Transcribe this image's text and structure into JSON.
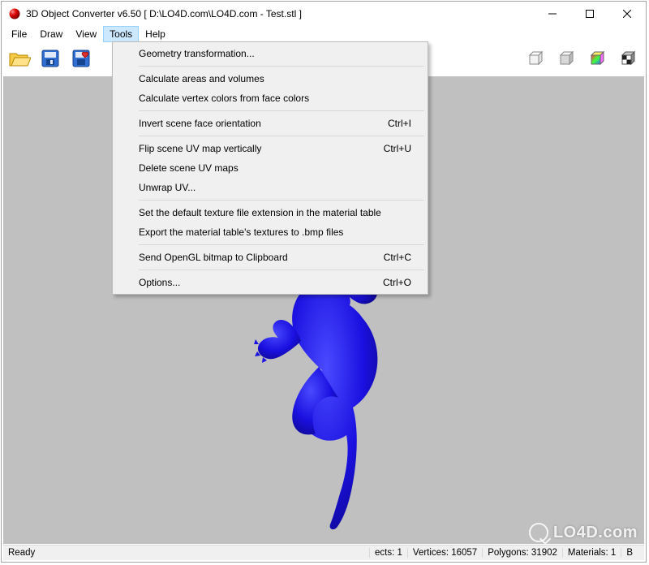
{
  "window": {
    "title": "3D Object Converter v6.50      [ D:\\LO4D.com\\LO4D.com - Test.stl ]"
  },
  "menubar": {
    "items": [
      "File",
      "Draw",
      "View",
      "Tools",
      "Help"
    ],
    "active_index": 3
  },
  "toolbar": {
    "left_icons": [
      "open-file-icon",
      "save-icon",
      "save-loved-icon"
    ],
    "right_icons": [
      "cube-wire-icon",
      "cube-solid-icon",
      "cube-rainbow-icon",
      "cube-checker-icon"
    ]
  },
  "dropdown": {
    "items": [
      {
        "type": "item",
        "label": "Geometry transformation...",
        "shortcut": ""
      },
      {
        "type": "sep"
      },
      {
        "type": "item",
        "label": "Calculate areas and volumes",
        "shortcut": ""
      },
      {
        "type": "item",
        "label": "Calculate vertex colors from face colors",
        "shortcut": ""
      },
      {
        "type": "sep"
      },
      {
        "type": "item",
        "label": "Invert scene face orientation",
        "shortcut": "Ctrl+I"
      },
      {
        "type": "sep"
      },
      {
        "type": "item",
        "label": "Flip scene UV map vertically",
        "shortcut": "Ctrl+U"
      },
      {
        "type": "item",
        "label": "Delete scene UV maps",
        "shortcut": ""
      },
      {
        "type": "item",
        "label": "Unwrap UV...",
        "shortcut": ""
      },
      {
        "type": "sep"
      },
      {
        "type": "item",
        "label": "Set the default texture file extension in the material table",
        "shortcut": ""
      },
      {
        "type": "item",
        "label": "Export the material table's textures to .bmp files",
        "shortcut": ""
      },
      {
        "type": "sep"
      },
      {
        "type": "item",
        "label": "Send OpenGL bitmap to Clipboard",
        "shortcut": "Ctrl+C"
      },
      {
        "type": "sep"
      },
      {
        "type": "item",
        "label": "Options...",
        "shortcut": "Ctrl+O"
      }
    ]
  },
  "statusbar": {
    "ready": "Ready",
    "cells": [
      "ects: 1",
      "Vertices: 16057",
      "Polygons: 31902",
      "Materials: 1",
      "B"
    ]
  },
  "watermark": "LO4D.com",
  "colors": {
    "viewport_bg": "#c0c0c0",
    "model": "#1a10e0"
  }
}
